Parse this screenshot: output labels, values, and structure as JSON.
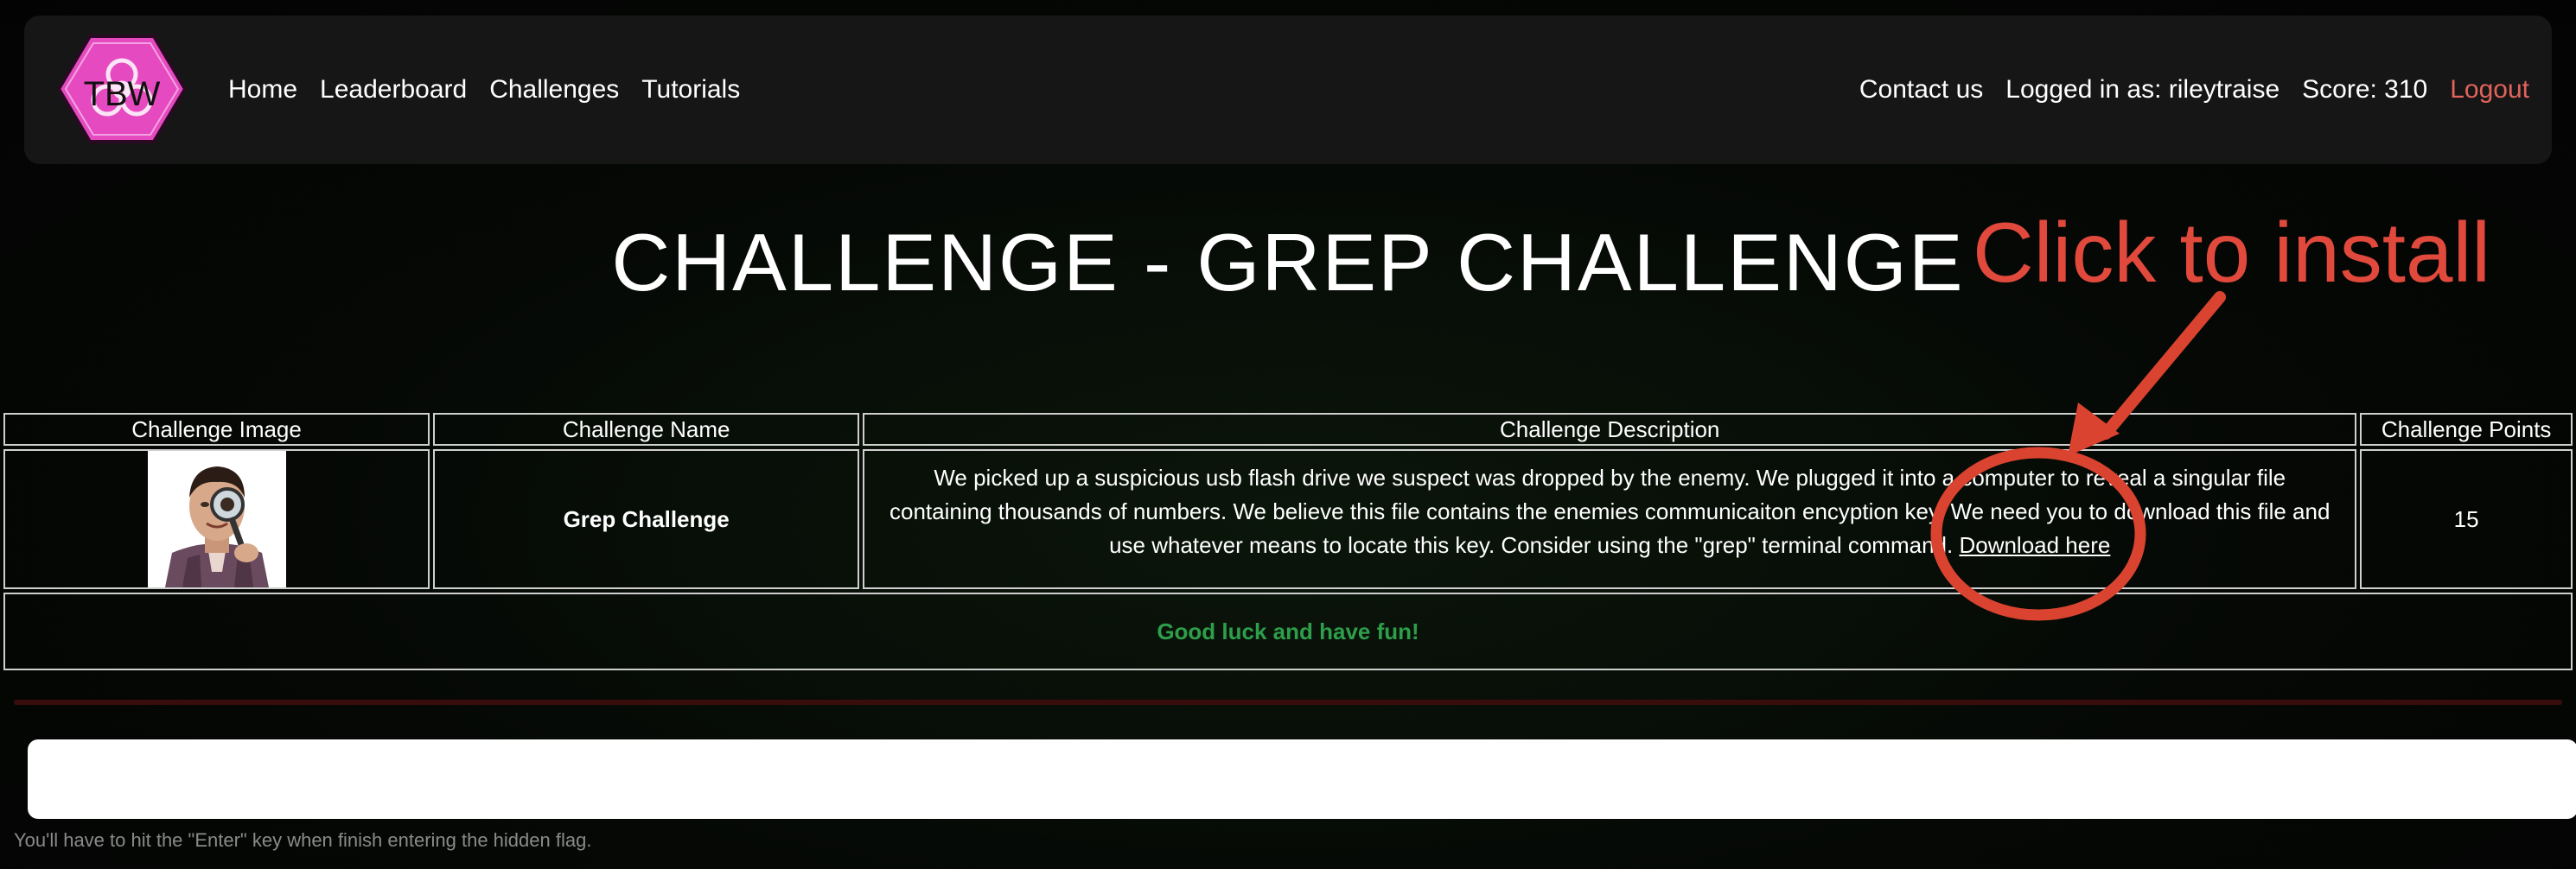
{
  "nav": {
    "logo_text": "TBW",
    "left_links": [
      "Home",
      "Leaderboard",
      "Challenges",
      "Tutorials"
    ],
    "contact": "Contact us",
    "logged_in": "Logged in as: rileytraise",
    "score": "Score: 310",
    "logout": "Logout"
  },
  "page": {
    "title": "CHALLENGE - GREP CHALLENGE"
  },
  "annotation": {
    "text": "Click to install",
    "color": "#e0493c"
  },
  "table": {
    "headers": [
      "Challenge Image",
      "Challenge Name",
      "Challenge Description",
      "Challenge Points"
    ],
    "row": {
      "name": "Grep Challenge",
      "description": "We picked up a suspicious usb flash drive we suspect was dropped by the enemy. We plugged it into a computer to reveal a singular file containing thousands of numbers. We believe this file contains the enemies communicaiton encyption key. We need you to download this file and use whatever means to locate this key. Consider using the \"grep\" terminal command.",
      "download_label": "Download here",
      "points": "15"
    },
    "footer": "Good luck and have fun!"
  },
  "flag": {
    "value": "",
    "placeholder": "",
    "hint": "You'll have to hit the \"Enter\" key when finish entering the hidden flag."
  },
  "colors": {
    "accent_pink": "#e64ac1",
    "logout": "#e0635c",
    "success": "#2e9e4a"
  }
}
